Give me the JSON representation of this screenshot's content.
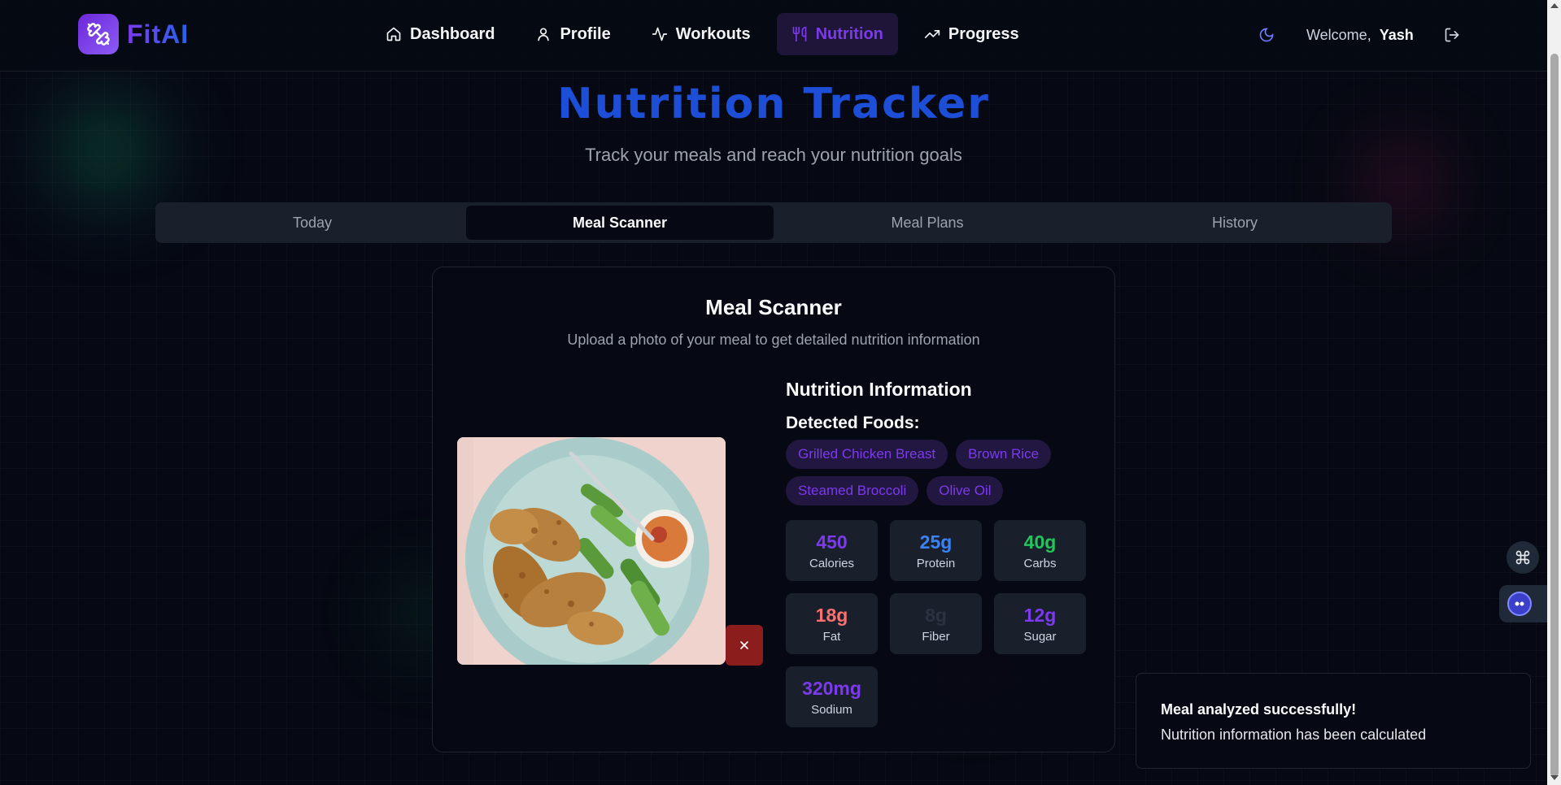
{
  "app": {
    "logo_text": "FitAI"
  },
  "nav": {
    "items": [
      {
        "label": "Dashboard",
        "icon": "home-icon"
      },
      {
        "label": "Profile",
        "icon": "user-icon"
      },
      {
        "label": "Workouts",
        "icon": "activity-icon"
      },
      {
        "label": "Nutrition",
        "icon": "utensils-icon",
        "active": true
      },
      {
        "label": "Progress",
        "icon": "trending-up-icon"
      }
    ]
  },
  "user": {
    "welcome": "Welcome,",
    "name": "Yash"
  },
  "header": {
    "title": "Nutrition Tracker",
    "subtitle": "Track your meals and reach your nutrition goals"
  },
  "tabs": [
    {
      "label": "Today"
    },
    {
      "label": "Meal Scanner",
      "active": true
    },
    {
      "label": "Meal Plans"
    },
    {
      "label": "History"
    }
  ],
  "scanner": {
    "title": "Meal Scanner",
    "description": "Upload a photo of your meal to get detailed nutrition information",
    "nutrition_title": "Nutrition Information",
    "detected_title": "Detected Foods:",
    "foods": [
      "Grilled Chicken Breast",
      "Brown Rice",
      "Steamed Broccoli",
      "Olive Oil"
    ],
    "stats": [
      {
        "value": "450",
        "label": "Calories",
        "color": "#7c3aed"
      },
      {
        "value": "25g",
        "label": "Protein",
        "color": "#3b82f6"
      },
      {
        "value": "40g",
        "label": "Carbs",
        "color": "#22c55e"
      },
      {
        "value": "18g",
        "label": "Fat",
        "color": "#f87171"
      },
      {
        "value": "8g",
        "label": "Fiber",
        "color": "#2a3140"
      },
      {
        "value": "12g",
        "label": "Sugar",
        "color": "#7c3aed"
      },
      {
        "value": "320mg",
        "label": "Sodium",
        "color": "#7c3aed"
      }
    ]
  },
  "toast": {
    "title": "Meal analyzed successfully!",
    "body": "Nutrition information has been calculated"
  },
  "colors": {
    "accent": "#7c3aed",
    "title_blue": "#1d4ed8",
    "danger": "#8b1d1d"
  }
}
